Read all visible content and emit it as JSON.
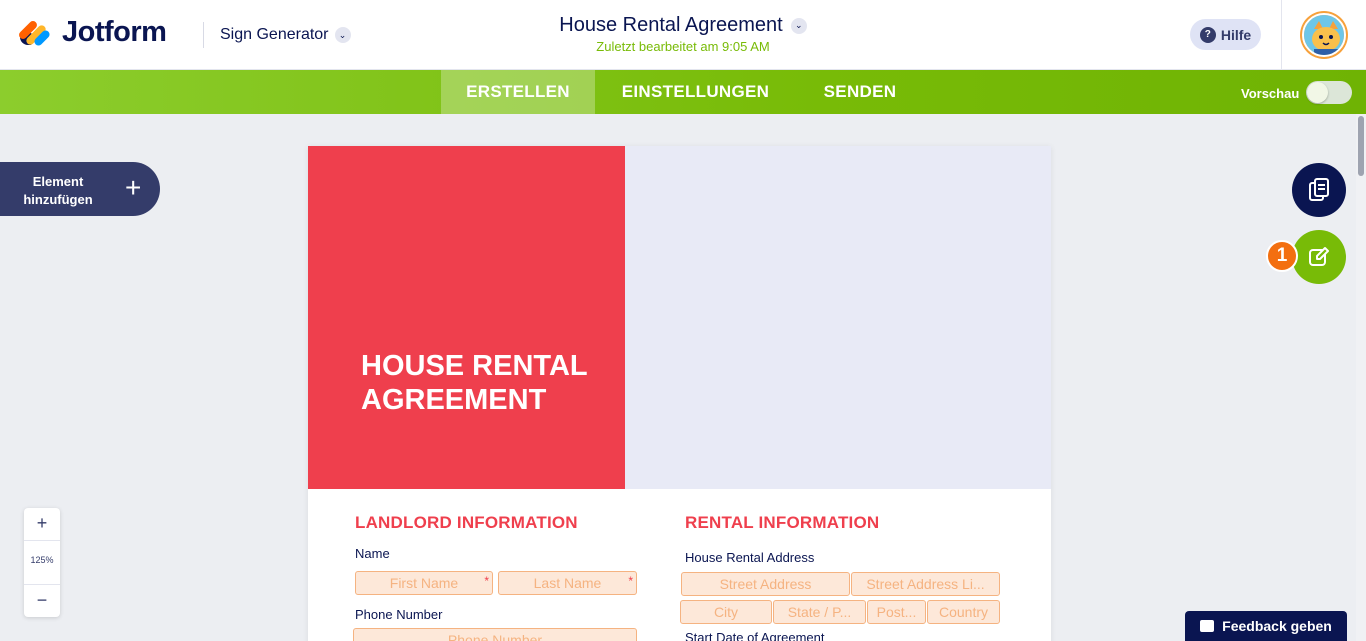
{
  "header": {
    "brand": "Jotform",
    "product": "Sign Generator",
    "document_title": "House Rental Agreement",
    "last_edited": "Zuletzt bearbeitet am 9:05 AM",
    "help_label": "Hilfe"
  },
  "nav": {
    "tabs": [
      {
        "label": "ERSTELLEN",
        "active": true
      },
      {
        "label": "EINSTELLUNGEN",
        "active": false
      },
      {
        "label": "SENDEN",
        "active": false
      }
    ],
    "preview_label": "Vorschau",
    "preview_on": false
  },
  "sidebar": {
    "add_element_label": "Element hinzufügen"
  },
  "zoom": {
    "plus": "+",
    "minus": "−",
    "level": "125%"
  },
  "right_tools": {
    "badge_count": "1"
  },
  "document": {
    "hero_title": "HOUSE RENTAL AGREEMENT",
    "landlord": {
      "heading": "LANDLORD INFORMATION",
      "name_label": "Name",
      "first_name": "First Name",
      "last_name": "Last Name",
      "phone_label": "Phone Number",
      "phone_placeholder": "Phone Number"
    },
    "rental": {
      "heading": "RENTAL INFORMATION",
      "address_label": "House Rental Address",
      "street": "Street Address",
      "street2": "Street Address Li...",
      "city": "City",
      "state": "State / P...",
      "postal": "Post...",
      "country": "Country",
      "start_label": "Start Date of Agreement"
    }
  },
  "feedback_label": "Feedback geben",
  "colors": {
    "brand_navy": "#0a1551",
    "green": "#78bb07",
    "hero_red": "#ef3f4d",
    "badge_orange": "#f36f10"
  }
}
